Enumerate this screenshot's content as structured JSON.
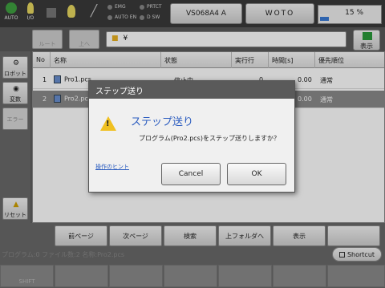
{
  "status": {
    "auto_label": "AUTO",
    "io_label": "I/O",
    "indicators": [
      "EMG",
      "PRTCT",
      "AUTO EN",
      "D SW"
    ],
    "robot_name": "VS068A4 A",
    "program_name": "WOTO",
    "progress_text": "15 %",
    "progress_value": 0.15
  },
  "toolbar": {
    "root_label": "ルート",
    "up_label": "上へ",
    "path": "¥",
    "show_label": "表示"
  },
  "side": {
    "robot_label": "ロボット",
    "variables_label": "変数",
    "error_label": "エラー",
    "reset_label": "リセット"
  },
  "table": {
    "headers": [
      "No",
      "名称",
      "状態",
      "実行行",
      "時間[s]",
      "優先順位"
    ],
    "rows": [
      {
        "no": "1",
        "name": "Pro1.pcs",
        "state": "停止中",
        "line": "0",
        "time": "0.00",
        "priority": "通常"
      },
      {
        "no": "2",
        "name": "Pro2.pcs",
        "state": "",
        "line": "",
        "time": "0.00",
        "priority": "通常"
      }
    ]
  },
  "bottom": {
    "prev_page": "前ページ",
    "next_page": "次ページ",
    "search": "検索",
    "parent_folder": "上フォルダへ",
    "show": "表示",
    "status_line": "プログラム:0  ファイル数:2  名称:Pro2.pcs",
    "shortcut": "Shortcut",
    "shift": "SHIFT"
  },
  "dialog": {
    "title": "ステップ送り",
    "heading": "ステップ送り",
    "message": "プログラム(Pro2.pcs)をステップ送りしますか？",
    "hint": "操作のヒント",
    "cancel": "Cancel",
    "ok": "OK"
  },
  "colors": {
    "accent_blue": "#2a5bbf",
    "warning_yellow": "#f0c020",
    "progress_fill": "#3a7bd5"
  }
}
